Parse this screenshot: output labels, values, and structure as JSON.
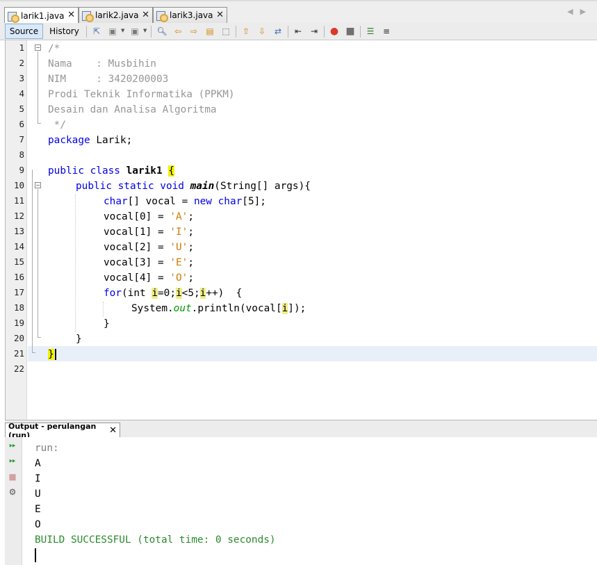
{
  "tabs": [
    {
      "label": "larik1.java",
      "active": true
    },
    {
      "label": "larik2.java",
      "active": false
    },
    {
      "label": "larik3.java",
      "active": false
    }
  ],
  "toolbar": {
    "source_label": "Source",
    "history_label": "History",
    "icons": [
      "last-edit-icon",
      "back-icon",
      "forward-icon",
      "find-icon",
      "find-previous-icon",
      "find-next-icon",
      "find-selection-icon",
      "toggle-highlight-icon",
      "previous-bookmark-icon",
      "next-bookmark-icon",
      "toggle-bookmark-icon",
      "shift-left-icon",
      "shift-right-icon",
      "start-macro-icon",
      "stop-macro-icon",
      "comment-icon",
      "uncomment-icon"
    ]
  },
  "editor": {
    "line_numbers": [
      "1",
      "2",
      "3",
      "4",
      "5",
      "6",
      "7",
      "8",
      "9",
      "10",
      "11",
      "12",
      "13",
      "14",
      "15",
      "16",
      "17",
      "18",
      "19",
      "20",
      "21",
      "22"
    ],
    "current_line": "21",
    "code": {
      "l1": "/*",
      "l2": "Nama    : Musbihin",
      "l3": "NIM     : 3420200003",
      "l4": "Prodi Teknik Informatika (PPKM)",
      "l5": "Desain dan Analisa Algoritma",
      "l6": " */",
      "l7_kw": "package",
      "l7_rest": " Larik;",
      "l9_kw": "public class",
      "l9_name": "larik1",
      "l9_brace": "{",
      "l10_kw": "public static void",
      "l10_name": "main",
      "l10_rest": "(String[] args){",
      "l11_kw1": "char",
      "l11_mid": "[] vocal = ",
      "l11_kw2": "new",
      "l11_kw3": "char",
      "l11_end": "[5];",
      "assign": [
        {
          "lhs": "vocal[0] = ",
          "val": "'A'",
          "end": ";"
        },
        {
          "lhs": "vocal[1] = ",
          "val": "'I'",
          "end": ";"
        },
        {
          "lhs": "vocal[2] = ",
          "val": "'U'",
          "end": ";"
        },
        {
          "lhs": "vocal[3] = ",
          "val": "'E'",
          "end": ";"
        },
        {
          "lhs": "vocal[4] = ",
          "val": "'O'",
          "end": ";"
        }
      ],
      "l17_kw": "for",
      "l17_a": "(int ",
      "l17_i1": "i",
      "l17_b": "=0;",
      "l17_i2": "i",
      "l17_c": "<5;",
      "l17_i3": "i",
      "l17_d": "++)  {",
      "l18_a": "System.",
      "l18_field": "out",
      "l18_b": ".println(vocal[",
      "l18_i": "i",
      "l18_c": "]);",
      "l19": "}",
      "l20": "}",
      "l21": "}"
    }
  },
  "output": {
    "title": "Output - perulangan (run)",
    "lines": [
      "run:",
      "A",
      "I",
      "U",
      "E",
      "O",
      "BUILD SUCCESSFUL (total time: 0 seconds)"
    ]
  },
  "colors": {
    "keyword": "#0000e6",
    "string": "#ce7b00",
    "comment": "#969696",
    "success": "#2c8a2c",
    "highlight": "#f2f200"
  }
}
